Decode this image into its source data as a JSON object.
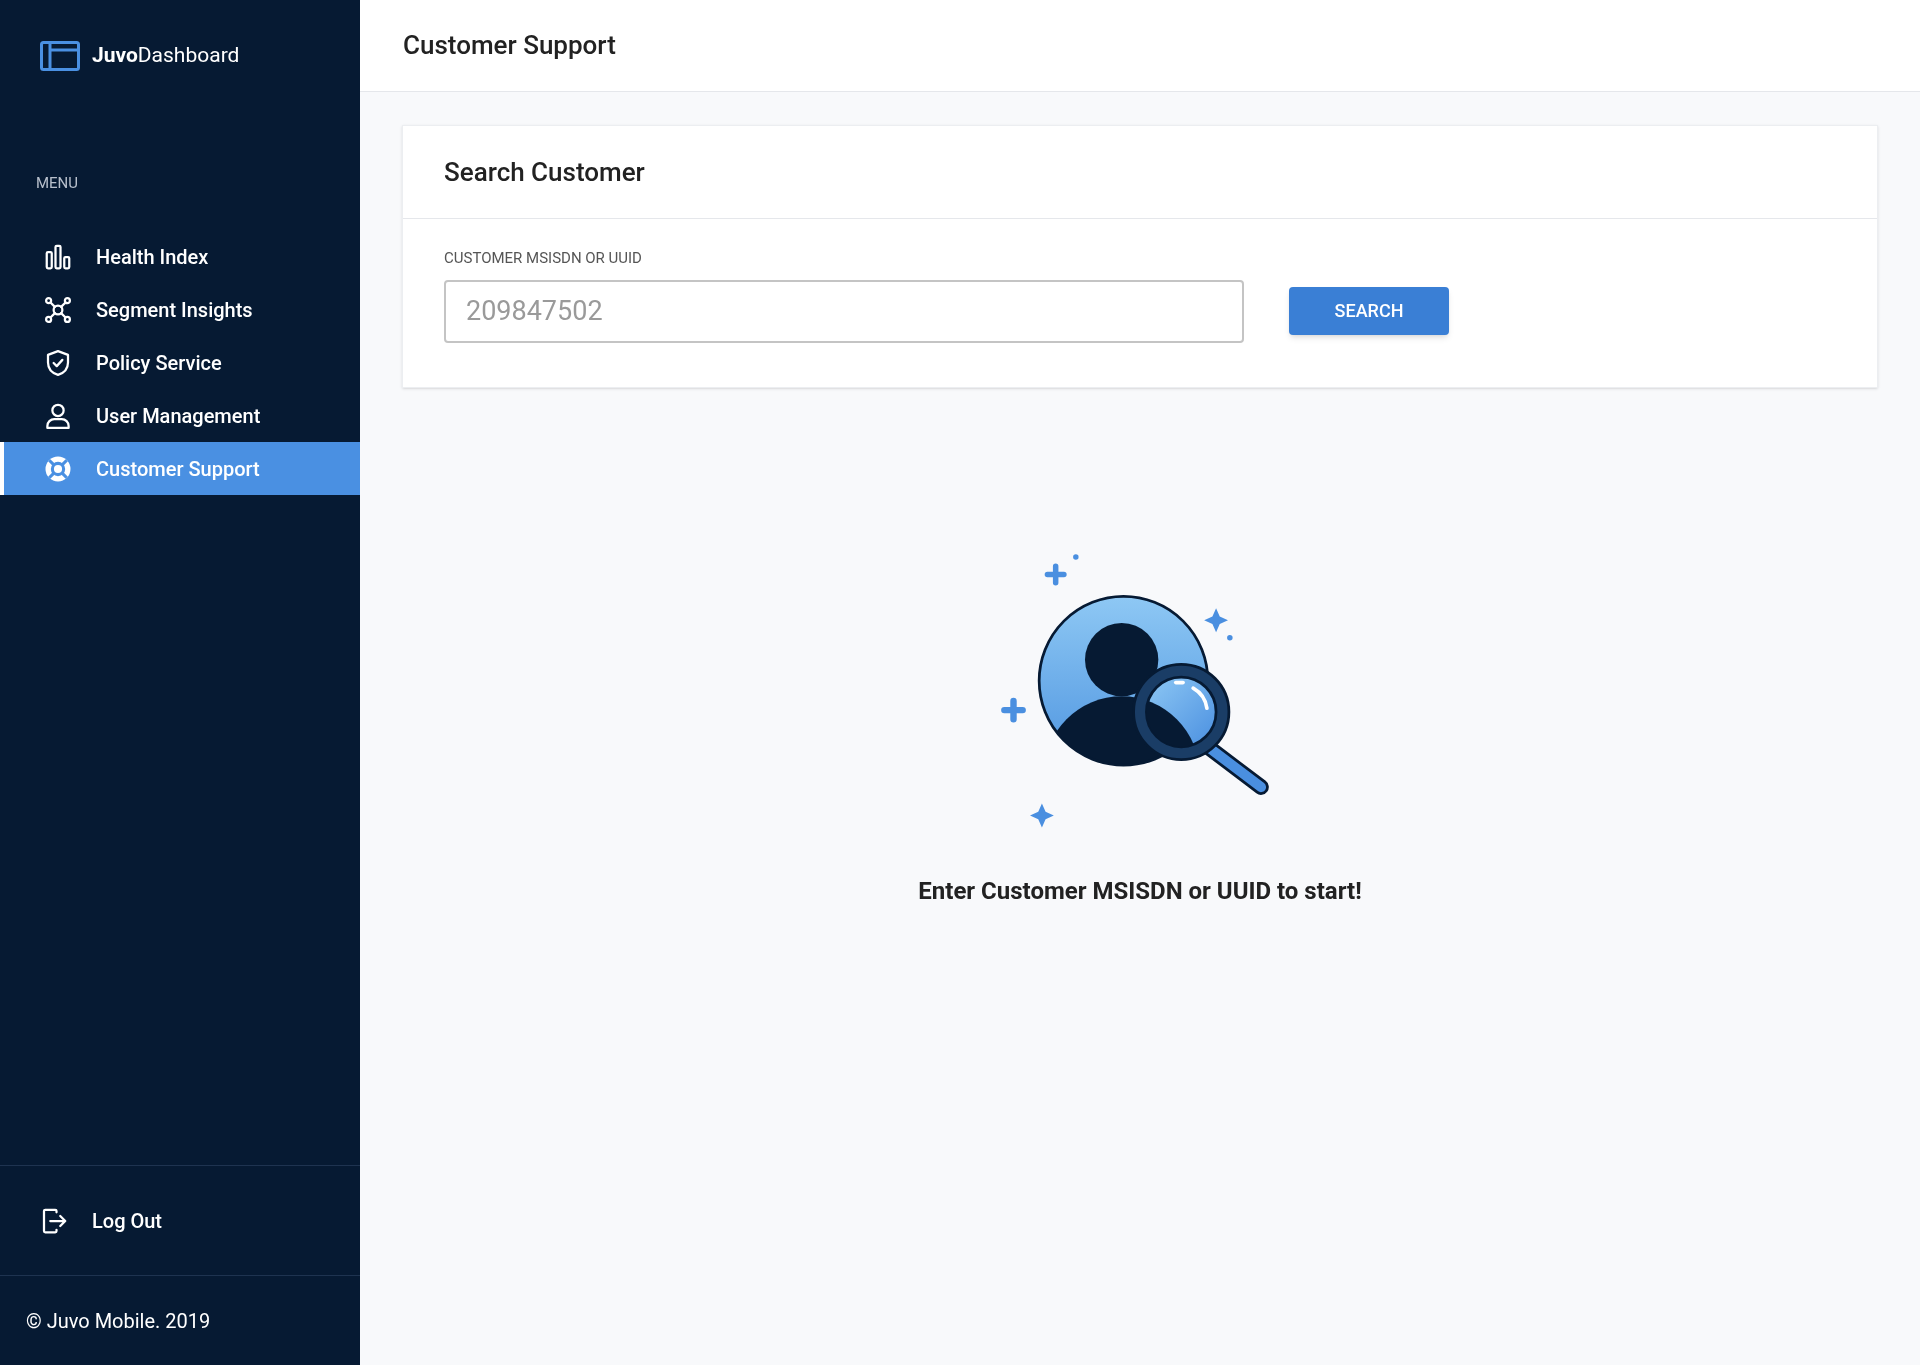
{
  "sidebar": {
    "logo": "**Juvo**Dashboard",
    "menu_label": "MENU",
    "items": [
      {
        "label": "Health Index",
        "kind": "chart",
        "selected": false
      },
      {
        "label": "Segment Insights",
        "kind": "network",
        "selected": false
      },
      {
        "label": "Policy Service",
        "kind": "shield",
        "selected": false
      },
      {
        "label": "User Management",
        "kind": "user",
        "selected": false
      },
      {
        "label": "Customer Support",
        "kind": "lifebuoy",
        "selected": true
      }
    ],
    "logout": "Log Out",
    "footer": "© Juvo Mobile. 2019"
  },
  "header": {
    "title": "Customer Support"
  },
  "search_card": {
    "title": "Search Customer",
    "field_label": "CUSTOMER MSISDN OR UUID",
    "placeholder": "209847502",
    "button": "SEARCH"
  },
  "empty_state": {
    "message": "Enter Customer MSISDN or UUID to start!"
  }
}
